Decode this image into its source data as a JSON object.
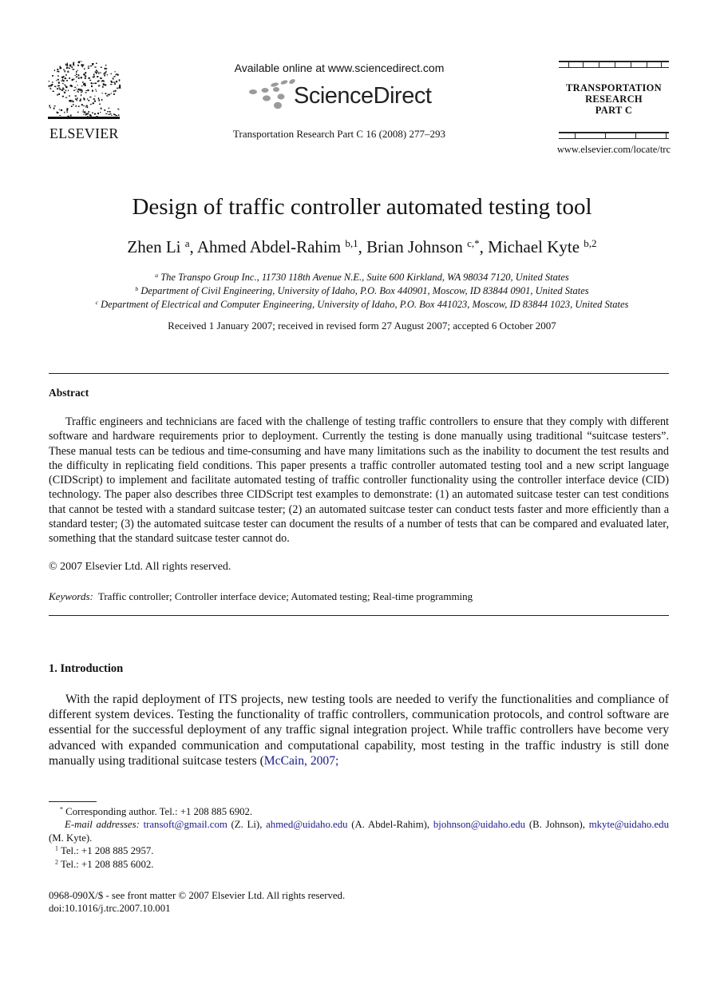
{
  "header": {
    "publisher_logo_text": "ELSEVIER",
    "available_online": "Available online at www.sciencedirect.com",
    "platform_logo_text": "ScienceDirect",
    "journal_citation": "Transportation Research Part C 16 (2008) 277–293",
    "journal_block": {
      "line1": "TRANSPORTATION",
      "line2": "RESEARCH",
      "line3": "PART C"
    },
    "journal_url": "www.elsevier.com/locate/trc"
  },
  "article": {
    "title": "Design of traffic controller automated testing tool",
    "authors": [
      {
        "name": "Zhen Li",
        "sup": "a",
        "sep": ", "
      },
      {
        "name": "Ahmed Abdel-Rahim",
        "sup": "b,1",
        "sep": ", "
      },
      {
        "name": "Brian Johnson",
        "sup": "c,*",
        "sep": ", "
      },
      {
        "name": "Michael Kyte",
        "sup": "b,2",
        "sep": ""
      }
    ],
    "affiliations": [
      {
        "mark": "a",
        "text": "The Transpo Group Inc., 11730 118th Avenue N.E., Suite 600 Kirkland, WA 98034 7120, United States"
      },
      {
        "mark": "b",
        "text": "Department of Civil Engineering, University of Idaho, P.O. Box 440901, Moscow, ID 83844 0901, United States"
      },
      {
        "mark": "c",
        "text": "Department of Electrical and Computer Engineering, University of Idaho, P.O. Box 441023, Moscow, ID 83844 1023, United States"
      }
    ],
    "received": "Received 1 January 2007; received in revised form 27 August 2007; accepted 6 October 2007"
  },
  "abstract": {
    "heading": "Abstract",
    "text": "Traffic engineers and technicians are faced with the challenge of testing traffic controllers to ensure that they comply with different software and hardware requirements prior to deployment. Currently the testing is done manually using traditional “suitcase testers”. These manual tests can be tedious and time-consuming and have many limitations such as the inability to document the test results and the difficulty in replicating field conditions. This paper presents a traffic controller automated testing tool and a new script language (CIDScript) to implement and facilitate automated testing of traffic controller functionality using the controller interface device (CID) technology. The paper also describes three CIDScript test examples to demonstrate: (1) an automated suitcase tester can test conditions that cannot be tested with a standard suitcase tester; (2) an automated suitcase tester can conduct tests faster and more efficiently than a standard tester; (3) the automated suitcase tester can document the results of a number of tests that can be compared and evaluated later, something that the standard suitcase tester cannot do.",
    "copyright": "© 2007 Elsevier Ltd. All rights reserved."
  },
  "keywords": {
    "label": "Keywords:",
    "text": "Traffic controller; Controller interface device; Automated testing; Real-time programming"
  },
  "introduction": {
    "heading": "1. Introduction",
    "text_before_link": "With the rapid deployment of ITS projects, new testing tools are needed to verify the functionalities and compliance of different system devices. Testing the functionality of traffic controllers, communication protocols, and control software are essential for the successful deployment of any traffic signal integration project. While traffic controllers have become very advanced with expanded communication and computational capability, most testing in the traffic industry is still done manually using traditional suitcase testers (",
    "citation_link": "McCain, 2007;"
  },
  "footnotes": {
    "corresponding": {
      "mark": "*",
      "text": "Corresponding author. Tel.: +1 208 885 6902."
    },
    "email_label": "E-mail addresses:",
    "emails": [
      {
        "address": "transoft@gmail.com",
        "owner": "(Z. Li),"
      },
      {
        "address": "ahmed@uidaho.edu",
        "owner": "(A. Abdel-Rahim),"
      },
      {
        "address": "bjohnson@uidaho.edu",
        "owner": "(B. Johnson),"
      },
      {
        "address": "mkyte@uidaho.edu",
        "owner": "(M. Kyte)."
      }
    ],
    "notes": [
      {
        "mark": "1",
        "text": "Tel.: +1 208 885 2957."
      },
      {
        "mark": "2",
        "text": "Tel.: +1 208 885 6002."
      }
    ]
  },
  "publication_info": {
    "issn_line": "0968-090X/$ - see front matter © 2007 Elsevier Ltd. All rights reserved.",
    "doi": "doi:10.1016/j.trc.2007.10.001"
  }
}
